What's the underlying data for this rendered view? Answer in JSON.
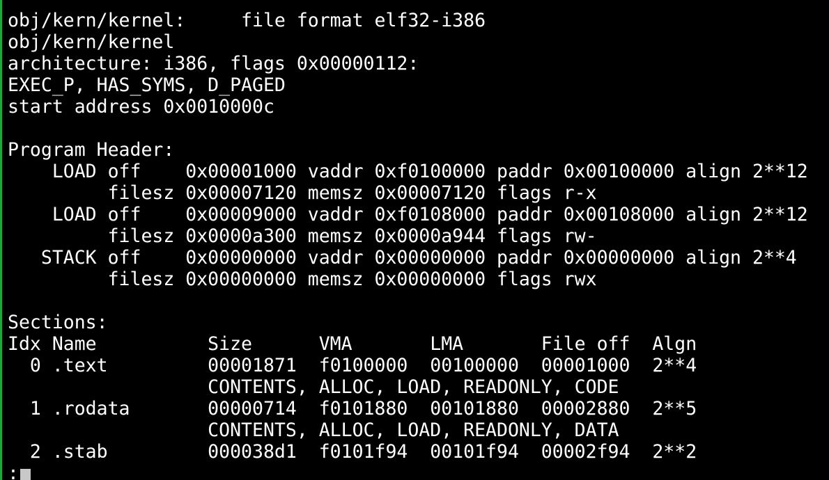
{
  "terminal": {
    "lines": [
      "obj/kern/kernel:     file format elf32-i386",
      "obj/kern/kernel",
      "architecture: i386, flags 0x00000112:",
      "EXEC_P, HAS_SYMS, D_PAGED",
      "start address 0x0010000c",
      "",
      "Program Header:",
      "    LOAD off    0x00001000 vaddr 0xf0100000 paddr 0x00100000 align 2**12",
      "         filesz 0x00007120 memsz 0x00007120 flags r-x",
      "    LOAD off    0x00009000 vaddr 0xf0108000 paddr 0x00108000 align 2**12",
      "         filesz 0x0000a300 memsz 0x0000a944 flags rw-",
      "   STACK off    0x00000000 vaddr 0x00000000 paddr 0x00000000 align 2**4",
      "         filesz 0x00000000 memsz 0x00000000 flags rwx",
      "",
      "Sections:",
      "Idx Name          Size      VMA       LMA       File off  Algn",
      "  0 .text         00001871  f0100000  00100000  00001000  2**4",
      "                  CONTENTS, ALLOC, LOAD, READONLY, CODE",
      "  1 .rodata       00000714  f0101880  00101880  00002880  2**5",
      "                  CONTENTS, ALLOC, LOAD, READONLY, DATA",
      "  2 .stab         000038d1  f0101f94  00101f94  00002f94  2**2"
    ],
    "prompt": ":"
  }
}
